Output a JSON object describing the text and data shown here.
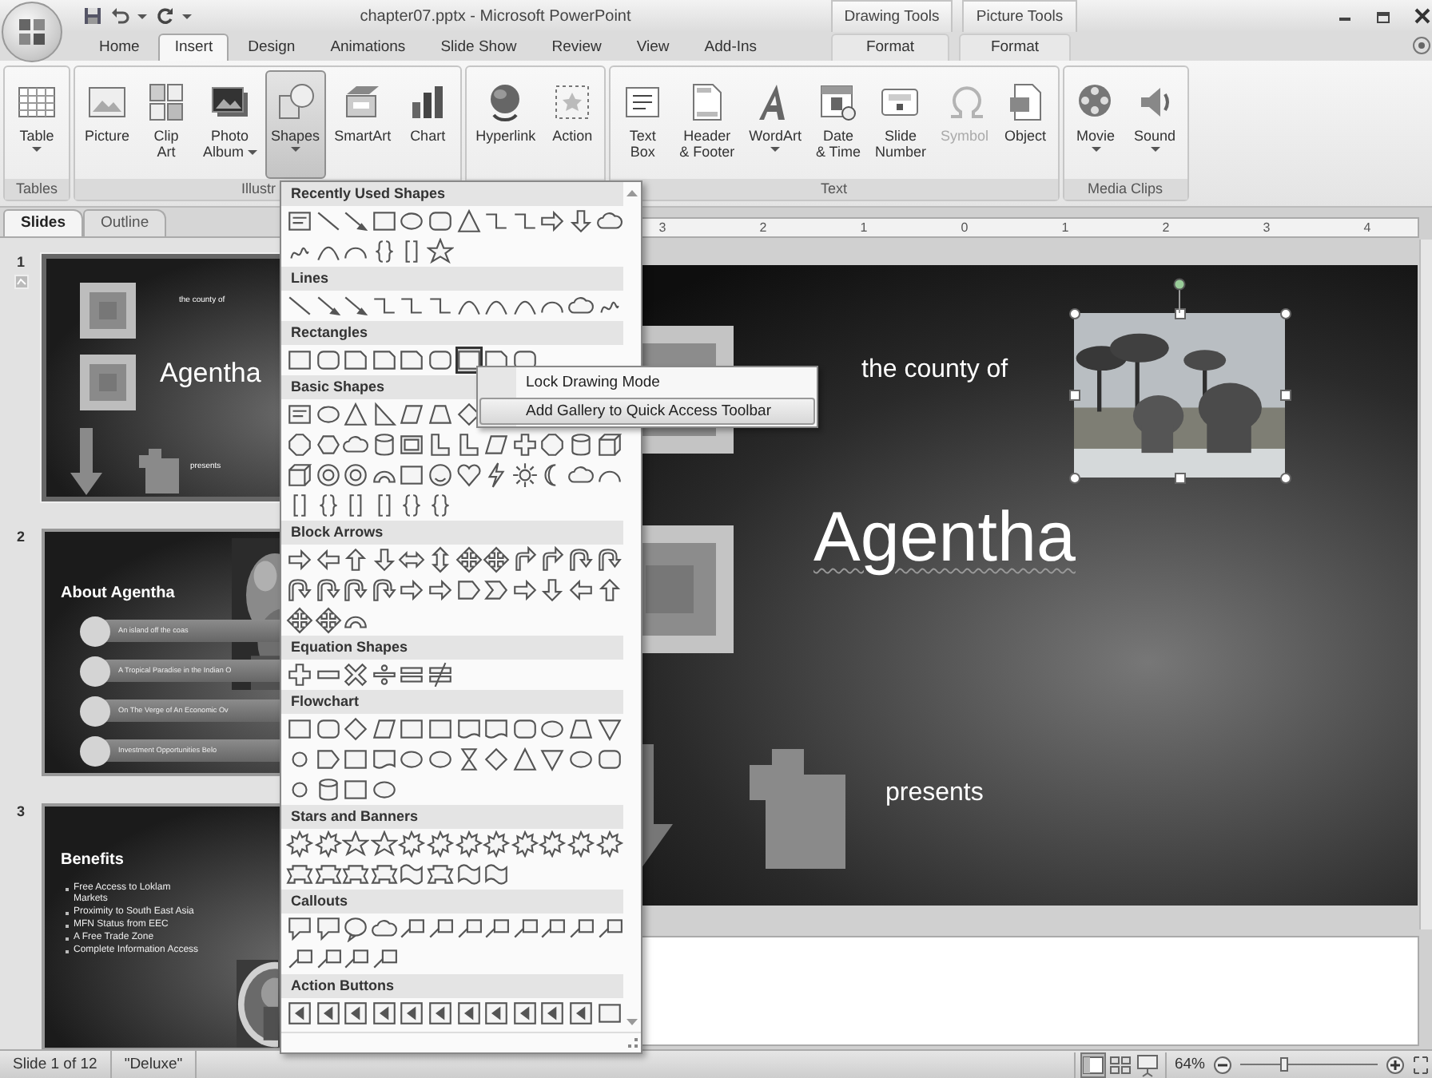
{
  "window": {
    "title": "chapter07.pptx - Microsoft PowerPoint"
  },
  "contextual_tabs": [
    {
      "group": "Drawing Tools",
      "tab": "Format",
      "selected": false
    },
    {
      "group": "Picture Tools",
      "tab": "Format",
      "selected": false
    }
  ],
  "tabs": [
    {
      "label": "Home",
      "selected": false
    },
    {
      "label": "Insert",
      "selected": true
    },
    {
      "label": "Design",
      "selected": false
    },
    {
      "label": "Animations",
      "selected": false
    },
    {
      "label": "Slide Show",
      "selected": false
    },
    {
      "label": "Review",
      "selected": false
    },
    {
      "label": "View",
      "selected": false
    },
    {
      "label": "Add-Ins",
      "selected": false
    }
  ],
  "ribbon": {
    "groups": [
      {
        "label": "Tables",
        "buttons": [
          {
            "label": "Table",
            "kind": "table",
            "dropdown": true,
            "selected": false,
            "disabled": false
          }
        ]
      },
      {
        "label": "Illustr",
        "buttons": [
          {
            "label": "Picture",
            "kind": "picture",
            "dropdown": false,
            "selected": false,
            "disabled": false
          },
          {
            "label": "Clip\nArt",
            "kind": "clipart",
            "dropdown": false,
            "selected": false,
            "disabled": false
          },
          {
            "label": "Photo\nAlbum",
            "kind": "album",
            "dropdown": true,
            "selected": false,
            "disabled": false
          },
          {
            "label": "Shapes",
            "kind": "shapes",
            "dropdown": true,
            "selected": true,
            "disabled": false
          },
          {
            "label": "SmartArt",
            "kind": "smartart",
            "dropdown": false,
            "selected": false,
            "disabled": false
          },
          {
            "label": "Chart",
            "kind": "chart",
            "dropdown": false,
            "selected": false,
            "disabled": false
          }
        ]
      },
      {
        "buttons": [
          {
            "label": "Hyperlink",
            "kind": "globe",
            "dropdown": false,
            "selected": false,
            "disabled": false
          },
          {
            "label": "Action",
            "kind": "action",
            "dropdown": false,
            "selected": false,
            "disabled": false
          }
        ]
      },
      {
        "label": "Text",
        "buttons": [
          {
            "label": "Text\nBox",
            "kind": "textbox",
            "dropdown": false,
            "selected": false,
            "disabled": false
          },
          {
            "label": "Header\n& Footer",
            "kind": "header",
            "dropdown": false,
            "selected": false,
            "disabled": false
          },
          {
            "label": "WordArt",
            "kind": "wordart",
            "dropdown": true,
            "selected": false,
            "disabled": false
          },
          {
            "label": "Date\n& Time",
            "kind": "datetime",
            "dropdown": false,
            "selected": false,
            "disabled": false
          },
          {
            "label": "Slide\nNumber",
            "kind": "slidenumber",
            "dropdown": false,
            "selected": false,
            "disabled": false
          },
          {
            "label": "Symbol",
            "kind": "symbol",
            "dropdown": false,
            "selected": false,
            "disabled": true
          },
          {
            "label": "Object",
            "kind": "object",
            "dropdown": false,
            "selected": false,
            "disabled": false
          }
        ]
      },
      {
        "label": "Media Clips",
        "buttons": [
          {
            "label": "Movie",
            "kind": "movie",
            "dropdown": true,
            "selected": false,
            "disabled": false
          },
          {
            "label": "Sound",
            "kind": "sound",
            "dropdown": true,
            "selected": false,
            "disabled": false
          }
        ]
      }
    ]
  },
  "slides_pane": {
    "tabs": [
      {
        "label": "Slides",
        "selected": true
      },
      {
        "label": "Outline",
        "selected": false
      }
    ],
    "slides": [
      {
        "number": "1",
        "kind": "title",
        "selected": true,
        "animated": true,
        "subtitle": "the county of",
        "title": "Agentha",
        "tagline": "presents"
      },
      {
        "number": "2",
        "kind": "list",
        "selected": false,
        "title": "About Agentha",
        "items": [
          "An island off the coas",
          "A Tropical Paradise in the Indian O",
          "On The Verge of An Economic Ov",
          "Investment Opportunities Belo"
        ]
      },
      {
        "number": "3",
        "kind": "bullets",
        "selected": false,
        "title": "Benefits",
        "items": [
          "Free Access to Loklam Markets",
          "Proximity to South East Asia",
          "MFN Status from EEC",
          "A Free Trade Zone",
          "Complete Information Access"
        ]
      }
    ]
  },
  "ruler": {
    "labels": [
      "3",
      "2",
      "1",
      "0",
      "1",
      "2",
      "3",
      "4"
    ]
  },
  "slide": {
    "subtitle": "the county of",
    "title": "Agentha",
    "title_misspelled": true,
    "tagline": "presents",
    "picture": {
      "kind": "picture",
      "selected": true
    }
  },
  "gallery": {
    "sections": [
      {
        "title": "Recently Used Shapes",
        "rows": [
          [
            {
              "kind": "textbox",
              "selected": false
            },
            {
              "kind": "line",
              "selected": false
            },
            {
              "kind": "arrowline",
              "selected": false
            },
            {
              "kind": "rect",
              "selected": false
            },
            {
              "kind": "oval",
              "selected": false
            },
            {
              "kind": "rrect",
              "selected": false
            },
            {
              "kind": "tri",
              "selected": false
            },
            {
              "kind": "elbow",
              "selected": false
            },
            {
              "kind": "elbow",
              "selected": false
            },
            {
              "kind": "rarrow",
              "selected": false
            },
            {
              "kind": "darrow",
              "selected": false
            },
            {
              "kind": "cloud",
              "selected": false
            }
          ],
          [
            {
              "kind": "freeform",
              "selected": false
            },
            {
              "kind": "curve",
              "selected": false
            },
            {
              "kind": "arc",
              "selected": false
            },
            {
              "kind": "brace",
              "selected": false
            },
            {
              "kind": "bracket",
              "selected": false
            },
            {
              "kind": "star",
              "selected": false
            }
          ]
        ]
      },
      {
        "title": "Lines",
        "rows": [
          [
            {
              "kind": "line",
              "selected": false
            },
            {
              "kind": "arrowline",
              "selected": false
            },
            {
              "kind": "arrowline",
              "selected": false
            },
            {
              "kind": "elbow",
              "selected": false
            },
            {
              "kind": "elbow",
              "selected": false
            },
            {
              "kind": "elbow",
              "selected": false
            },
            {
              "kind": "curve",
              "selected": false
            },
            {
              "kind": "curve",
              "selected": false
            },
            {
              "kind": "curve",
              "selected": false
            },
            {
              "kind": "arc",
              "selected": false
            },
            {
              "kind": "cloud",
              "selected": false
            },
            {
              "kind": "freeform",
              "selected": false
            }
          ]
        ]
      },
      {
        "title": "Rectangles",
        "rows": [
          [
            {
              "kind": "rect",
              "selected": false
            },
            {
              "kind": "rrect",
              "selected": false
            },
            {
              "kind": "snip",
              "selected": false
            },
            {
              "kind": "snip",
              "selected": false
            },
            {
              "kind": "snip",
              "selected": false
            },
            {
              "kind": "rrect",
              "selected": false
            },
            {
              "kind": "rect",
              "selected": true
            },
            {
              "kind": "snip",
              "selected": false
            },
            {
              "kind": "rrect",
              "selected": false
            }
          ]
        ]
      },
      {
        "title": "Basic Shapes",
        "rows": [
          [
            {
              "kind": "textbox",
              "selected": false
            },
            {
              "kind": "oval",
              "selected": false
            },
            {
              "kind": "tri",
              "selected": false
            },
            {
              "kind": "rtri",
              "selected": false
            },
            {
              "kind": "para",
              "selected": false
            },
            {
              "kind": "trap",
              "selected": false
            },
            {
              "kind": "diamond",
              "selected": false
            }
          ],
          [
            {
              "kind": "oct",
              "selected": false
            },
            {
              "kind": "hex",
              "selected": false
            },
            {
              "kind": "cloud",
              "selected": false
            },
            {
              "kind": "can",
              "selected": false
            },
            {
              "kind": "frame",
              "selected": false
            },
            {
              "kind": "lshape",
              "selected": false
            },
            {
              "kind": "lshape",
              "selected": false
            },
            {
              "kind": "para",
              "selected": false
            },
            {
              "kind": "cross",
              "selected": false
            },
            {
              "kind": "oct",
              "selected": false
            },
            {
              "kind": "can",
              "selected": false
            },
            {
              "kind": "cube",
              "selected": false
            }
          ],
          [
            {
              "kind": "cube",
              "selected": false
            },
            {
              "kind": "donut",
              "selected": false
            },
            {
              "kind": "donut",
              "selected": false
            },
            {
              "kind": "blockarc",
              "selected": false
            },
            {
              "kind": "rect",
              "selected": false
            },
            {
              "kind": "smile",
              "selected": false
            },
            {
              "kind": "heart",
              "selected": false
            },
            {
              "kind": "bolt",
              "selected": false
            },
            {
              "kind": "sun",
              "selected": false
            },
            {
              "kind": "moon",
              "selected": false
            },
            {
              "kind": "cloud",
              "selected": false
            },
            {
              "kind": "arc",
              "selected": false
            }
          ],
          [
            {
              "kind": "bracket",
              "selected": false
            },
            {
              "kind": "brace",
              "selected": false
            },
            {
              "kind": "bracket",
              "selected": false
            },
            {
              "kind": "bracket",
              "selected": false
            },
            {
              "kind": "brace",
              "selected": false
            },
            {
              "kind": "brace",
              "selected": false
            }
          ]
        ]
      },
      {
        "title": "Block Arrows",
        "rows": [
          [
            {
              "kind": "rarrow",
              "selected": false
            },
            {
              "kind": "larrow",
              "selected": false
            },
            {
              "kind": "uarrow",
              "selected": false
            },
            {
              "kind": "darrow",
              "selected": false
            },
            {
              "kind": "lrarrow",
              "selected": false
            },
            {
              "kind": "udarrow",
              "selected": false
            },
            {
              "kind": "quadarrow",
              "selected": false
            },
            {
              "kind": "quadarrow",
              "selected": false
            },
            {
              "kind": "bentarrow",
              "selected": false
            },
            {
              "kind": "bentarrow",
              "selected": false
            },
            {
              "kind": "uturn",
              "selected": false
            },
            {
              "kind": "uturn",
              "selected": false
            }
          ],
          [
            {
              "kind": "uturn",
              "selected": false
            },
            {
              "kind": "uturn",
              "selected": false
            },
            {
              "kind": "uturn",
              "selected": false
            },
            {
              "kind": "uturn",
              "selected": false
            },
            {
              "kind": "rarrow",
              "selected": false
            },
            {
              "kind": "rarrow",
              "selected": false
            },
            {
              "kind": "pentagon",
              "selected": false
            },
            {
              "kind": "chevron",
              "selected": false
            },
            {
              "kind": "rarrow",
              "selected": false
            },
            {
              "kind": "darrow",
              "selected": false
            },
            {
              "kind": "larrow",
              "selected": false
            },
            {
              "kind": "uarrow",
              "selected": false
            }
          ],
          [
            {
              "kind": "quadarrow",
              "selected": false
            },
            {
              "kind": "quadarrow",
              "selected": false
            },
            {
              "kind": "blockarc",
              "selected": false
            }
          ]
        ]
      },
      {
        "title": "Equation Shapes",
        "rows": [
          [
            {
              "kind": "plus",
              "selected": false
            },
            {
              "kind": "minus",
              "selected": false
            },
            {
              "kind": "times",
              "selected": false
            },
            {
              "kind": "divide",
              "selected": false
            },
            {
              "kind": "equal",
              "selected": false
            },
            {
              "kind": "notequal",
              "selected": false
            }
          ]
        ]
      },
      {
        "title": "Flowchart",
        "rows": [
          [
            {
              "kind": "rect",
              "selected": false
            },
            {
              "kind": "rrect",
              "selected": false
            },
            {
              "kind": "diamond",
              "selected": false
            },
            {
              "kind": "para",
              "selected": false
            },
            {
              "kind": "rect",
              "selected": false
            },
            {
              "kind": "rect",
              "selected": false
            },
            {
              "kind": "doc",
              "selected": false
            },
            {
              "kind": "doc",
              "selected": false
            },
            {
              "kind": "rrect",
              "selected": false
            },
            {
              "kind": "oval",
              "selected": false
            },
            {
              "kind": "trap",
              "selected": false
            },
            {
              "kind": "merge",
              "selected": false
            }
          ],
          [
            {
              "kind": "circle",
              "selected": false
            },
            {
              "kind": "pentagon",
              "selected": false
            },
            {
              "kind": "rect",
              "selected": false
            },
            {
              "kind": "doc",
              "selected": false
            },
            {
              "kind": "oval",
              "selected": false
            },
            {
              "kind": "oval",
              "selected": false
            },
            {
              "kind": "hourglass",
              "selected": false
            },
            {
              "kind": "diamond",
              "selected": false
            },
            {
              "kind": "tri",
              "selected": false
            },
            {
              "kind": "merge",
              "selected": false
            },
            {
              "kind": "oval",
              "selected": false
            },
            {
              "kind": "rrect",
              "selected": false
            }
          ],
          [
            {
              "kind": "circle",
              "selected": false
            },
            {
              "kind": "can",
              "selected": false
            },
            {
              "kind": "rect",
              "selected": false
            },
            {
              "kind": "oval",
              "selected": false
            }
          ]
        ]
      },
      {
        "title": "Stars and Banners",
        "rows": [
          [
            {
              "kind": "seal",
              "selected": false
            },
            {
              "kind": "seal",
              "selected": false
            },
            {
              "kind": "star",
              "selected": false
            },
            {
              "kind": "star",
              "selected": false
            },
            {
              "kind": "seal",
              "selected": false
            },
            {
              "kind": "seal",
              "selected": false
            },
            {
              "kind": "seal",
              "selected": false
            },
            {
              "kind": "seal",
              "selected": false
            },
            {
              "kind": "seal",
              "selected": false
            },
            {
              "kind": "seal",
              "selected": false
            },
            {
              "kind": "seal",
              "selected": false
            },
            {
              "kind": "seal",
              "selected": false
            }
          ],
          [
            {
              "kind": "banner",
              "selected": false
            },
            {
              "kind": "banner",
              "selected": false
            },
            {
              "kind": "banner",
              "selected": false
            },
            {
              "kind": "banner",
              "selected": false
            },
            {
              "kind": "wave",
              "selected": false
            },
            {
              "kind": "banner",
              "selected": false
            },
            {
              "kind": "wave",
              "selected": false
            },
            {
              "kind": "wave",
              "selected": false
            }
          ]
        ]
      },
      {
        "title": "Callouts",
        "rows": [
          [
            {
              "kind": "callout",
              "selected": false
            },
            {
              "kind": "callout",
              "selected": false
            },
            {
              "kind": "ovalcallout",
              "selected": false
            },
            {
              "kind": "cloud",
              "selected": false
            },
            {
              "kind": "linecallout",
              "selected": false
            },
            {
              "kind": "linecallout",
              "selected": false
            },
            {
              "kind": "linecallout",
              "selected": false
            },
            {
              "kind": "linecallout",
              "selected": false
            },
            {
              "kind": "linecallout",
              "selected": false
            },
            {
              "kind": "linecallout",
              "selected": false
            },
            {
              "kind": "linecallout",
              "selected": false
            },
            {
              "kind": "linecallout",
              "selected": false
            }
          ],
          [
            {
              "kind": "linecallout",
              "selected": false
            },
            {
              "kind": "linecallout",
              "selected": false
            },
            {
              "kind": "linecallout",
              "selected": false
            },
            {
              "kind": "linecallout",
              "selected": false
            }
          ]
        ]
      },
      {
        "title": "Action Buttons",
        "rows": [
          [
            {
              "kind": "action",
              "selected": false
            },
            {
              "kind": "action",
              "selected": false
            },
            {
              "kind": "action",
              "selected": false
            },
            {
              "kind": "action",
              "selected": false
            },
            {
              "kind": "action",
              "selected": false
            },
            {
              "kind": "action",
              "selected": false
            },
            {
              "kind": "action",
              "selected": false
            },
            {
              "kind": "action",
              "selected": false
            },
            {
              "kind": "action",
              "selected": false
            },
            {
              "kind": "action",
              "selected": false
            },
            {
              "kind": "action",
              "selected": false
            },
            {
              "kind": "rect",
              "selected": false
            }
          ]
        ]
      }
    ]
  },
  "context_menu": {
    "items": [
      {
        "label": "Lock Drawing Mode",
        "selected": false
      },
      {
        "label": "Add Gallery to Quick Access Toolbar",
        "selected": true
      }
    ]
  },
  "status_bar": {
    "slide": "Slide 1 of 12",
    "theme": "\"Deluxe\"",
    "views": [
      {
        "kind": "normal",
        "selected": true
      },
      {
        "kind": "sorter",
        "selected": false
      },
      {
        "kind": "show",
        "selected": false
      }
    ],
    "zoom": {
      "reading": "64%",
      "level": 0.32
    }
  }
}
